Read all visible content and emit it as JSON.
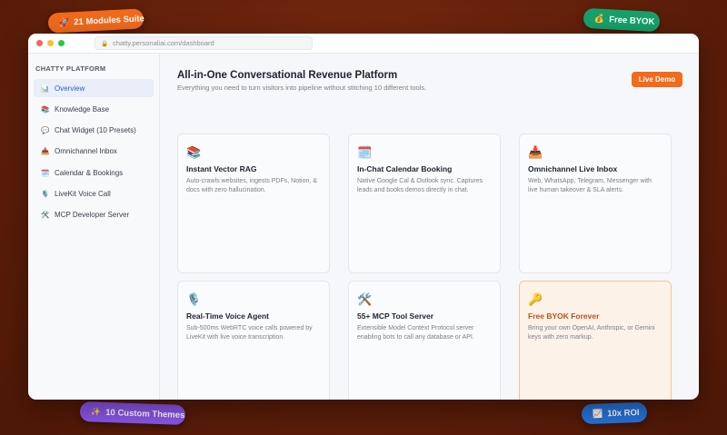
{
  "badges": {
    "modules": {
      "icon": "🚀",
      "label": "21 Modules Suite"
    },
    "byok": {
      "icon": "💰",
      "label": "Free BYOK"
    },
    "themes": {
      "icon": "✨",
      "label": "10 Custom Themes"
    },
    "roi": {
      "icon": "📈",
      "label": "10x ROI"
    }
  },
  "browser": {
    "url": "chatty.personaliai.com/dashboard",
    "lock_icon": "🔒"
  },
  "sidebar": {
    "heading": "CHATTY PLATFORM",
    "items": [
      {
        "icon": "📊",
        "label": "Overview",
        "active": true
      },
      {
        "icon": "📚",
        "label": "Knowledge Base"
      },
      {
        "icon": "💬",
        "label": "Chat Widget (10 Presets)"
      },
      {
        "icon": "📥",
        "label": "Omnichannel Inbox"
      },
      {
        "icon": "🗓️",
        "label": "Calendar & Bookings"
      },
      {
        "icon": "🎙️",
        "label": "LiveKit Voice Call"
      },
      {
        "icon": "🛠️",
        "label": "MCP Developer Server"
      }
    ]
  },
  "main": {
    "title": "All-in-One Conversational Revenue Platform",
    "subtitle": "Everything you need to turn visitors into pipeline without stitching 10 different tools.",
    "live_demo_label": "Live Demo",
    "cards": [
      {
        "icon": "📚",
        "title": "Instant Vector RAG",
        "desc": "Auto-crawls websites, ingests PDFs, Notion, & docs with zero hallucination."
      },
      {
        "icon": "🗓️",
        "title": "In-Chat Calendar Booking",
        "desc": "Native Google Cal & Outlook sync. Captures leads and books demos directly in chat."
      },
      {
        "icon": "📥",
        "title": "Omnichannel Live Inbox",
        "desc": "Web, WhatsApp, Telegram, Messenger with live human takeover & SLA alerts."
      },
      {
        "icon": "🎙️",
        "title": "Real-Time Voice Agent",
        "desc": "Sub-500ms WebRTC voice calls powered by LiveKit with live voice transcription."
      },
      {
        "icon": "🛠️",
        "title": "55+ MCP Tool Server",
        "desc": "Extensible Model Context Protocol server enabling bots to call any database or API."
      },
      {
        "icon": "🔑",
        "title": "Free BYOK Forever",
        "desc": "Bring your own OpenAI, Anthropic, or Gemini keys with zero markup."
      }
    ]
  },
  "colors": {
    "accent": "#f26a1b",
    "active_nav": "#2b5fc8",
    "background": "#5e1e0a"
  }
}
